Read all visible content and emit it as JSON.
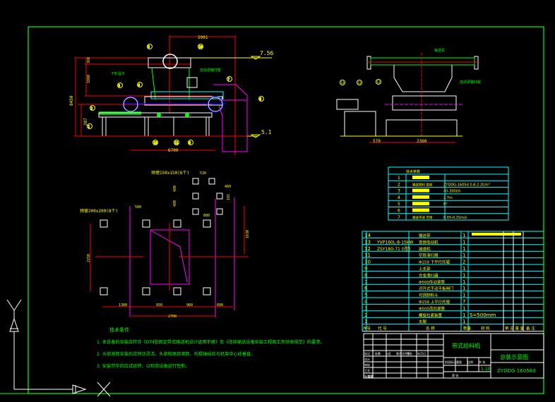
{
  "colors": {
    "background": "#000000",
    "frame": "#00ff00",
    "dimension": "#ff0000",
    "table": "#00ffff",
    "text": "#ffff00",
    "outline": "#ffffff",
    "hopper": "#ff00ff"
  },
  "ucs_icon": {
    "x_label": "X",
    "y_label": "Y"
  },
  "elevation_view": {
    "dims": {
      "top": "5901",
      "height_total": "8450",
      "height_a": "360",
      "height_b": "1800",
      "leg": "387",
      "base": "6700"
    },
    "levels": {
      "top": "7.56",
      "bottom": "5.1"
    },
    "balloons": [
      "5",
      "10",
      "3",
      "4",
      "2",
      "1",
      "13",
      "11",
      "8",
      "7",
      "6"
    ],
    "notes": [
      "下料溜子",
      "自动调偏托辊"
    ]
  },
  "side_view": {
    "dims": {
      "a": "570",
      "b": "2360"
    },
    "balloons": [
      "14",
      "12",
      "11",
      "3"
    ],
    "notes": [
      "输送机",
      "自动调偏托辊"
    ]
  },
  "foundation_plan": {
    "labels": {
      "small_holes": "预埋150x150(6个)",
      "large_holes": "预留200x200(8个)"
    },
    "dims": {
      "d530": "530",
      "d460": "460",
      "d480a": "480",
      "d480b": "480",
      "d800": "800",
      "d181": "181",
      "d500": "500",
      "d1630": "1630",
      "d2150": "2150",
      "d1380": "1380",
      "d950": "950",
      "d960": "960",
      "d890": "890",
      "d2700": "2700"
    }
  },
  "spec_table": {
    "title": "技术参数",
    "rows": [
      {
        "no": "1",
        "name": "",
        "value": ""
      },
      {
        "no": "2",
        "name": "输送物料 密度",
        "value": "ZYDDG-1605d 0.8-2.2t/m³"
      },
      {
        "no": "3",
        "name": "",
        "value": "40-300t/h"
      },
      {
        "no": "4",
        "name": "",
        "value": "2.7m"
      },
      {
        "no": "5",
        "name": "",
        "value": "0°"
      },
      {
        "no": "6",
        "name": "",
        "value": ""
      },
      {
        "no": "7",
        "name": "输送带速 范围",
        "value": "0.05-0.15m/s"
      }
    ]
  },
  "parts_table": {
    "rows": [
      {
        "no": "14",
        "code": "",
        "name": "输送带",
        "qty": "1",
        "material": "",
        "note": ""
      },
      {
        "no": "13",
        "code": "YVP160L-8-15kW",
        "name": "变频电动机",
        "qty": "1",
        "material": "",
        "note": ""
      },
      {
        "no": "12",
        "code": "ZSY180-71 (I型)",
        "name": "减速机",
        "qty": "1",
        "material": "",
        "note": ""
      },
      {
        "no": "11",
        "code": "",
        "name": "空段清扫器",
        "qty": "1",
        "material": "",
        "note": ""
      },
      {
        "no": "10",
        "code": "",
        "name": "Φ159 下平行托辊",
        "qty": "2",
        "material": "",
        "note": ""
      },
      {
        "no": "9",
        "code": "",
        "name": "上支架",
        "qty": "1",
        "material": "",
        "note": ""
      },
      {
        "no": "8",
        "code": "",
        "name": "合金清扫器",
        "qty": "1",
        "material": "",
        "note": ""
      },
      {
        "no": "7",
        "code": "",
        "name": "Φ500传动滚筒",
        "qty": "1",
        "material": "",
        "note": ""
      },
      {
        "no": "6",
        "code": "",
        "name": "对开式手动平板闸门",
        "qty": "1",
        "material": "",
        "note": ""
      },
      {
        "no": "5",
        "code": "",
        "name": "可调卸料斗",
        "qty": "1",
        "material": "",
        "note": ""
      },
      {
        "no": "4",
        "code": "",
        "name": "Φ159 上平行托辊",
        "qty": "7",
        "material": "",
        "note": ""
      },
      {
        "no": "3",
        "code": "",
        "name": "Φ500改向滚筒",
        "qty": "1",
        "material": "",
        "note": ""
      },
      {
        "no": "2",
        "code": "",
        "name": "螺旋拉紧装置",
        "qty": "1",
        "material": "S=500mm",
        "note": ""
      },
      {
        "no": "1",
        "code": "",
        "name": "支腿",
        "qty": "1",
        "material": "",
        "note": ""
      }
    ],
    "headers": {
      "no": "序号",
      "code": "代 号",
      "name": "名 称",
      "qty": "数量",
      "material": "材 料",
      "weight": "单 总 重 量",
      "note": "备 注"
    }
  },
  "title_block": {
    "product": "带式给料机",
    "drawing": "总装示意图",
    "number": "ZYDDG-16056d",
    "scale": "1:10",
    "left_labels": [
      "标记",
      "处数",
      "分区",
      "更改文件号",
      "签名",
      "年月日",
      "设计",
      "审核",
      "工艺",
      "标准化",
      "批准"
    ],
    "mid_labels": [
      "阶段标记",
      "重量",
      "比例",
      "共 张",
      "第 张"
    ]
  },
  "notes": {
    "title": "技术条件",
    "items": [
      "1. 本设备的安装应符合《DTⅡ型固定带式输送机设计选用手册》及《连续输送设备安装工程施工及验收规范》的要求。",
      "2. 头部滚筒安装后应转动灵活，头部和尾部滚筒、托辊轴线应与机架中心线垂直。",
      "3. 安装完毕后应试运转，以检验设备运行性能。"
    ]
  }
}
